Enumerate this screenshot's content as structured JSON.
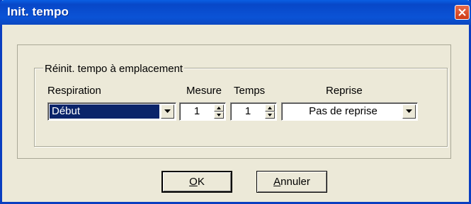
{
  "dialog": {
    "title": "Init. tempo",
    "group_legend": "Réinit. tempo à emplacement",
    "labels": {
      "respiration": "Respiration",
      "mesure": "Mesure",
      "temps": "Temps",
      "reprise": "Reprise"
    },
    "respiration_value": "Début",
    "mesure_value": "1",
    "temps_value": "1",
    "reprise_value": "Pas de reprise",
    "buttons": {
      "ok": {
        "mnemonic": "O",
        "rest": "K"
      },
      "cancel": {
        "mnemonic": "A",
        "rest": "nnuler"
      }
    }
  },
  "colors": {
    "titlebar": "#0a53d6",
    "dialog_background": "#ece9d8",
    "selection": "#0a246a",
    "close_button": "#d9532c"
  },
  "icons": {
    "close": "close-icon",
    "dropdown": "chevron-down-icon",
    "spin_up": "triangle-up-icon",
    "spin_down": "triangle-down-icon"
  }
}
